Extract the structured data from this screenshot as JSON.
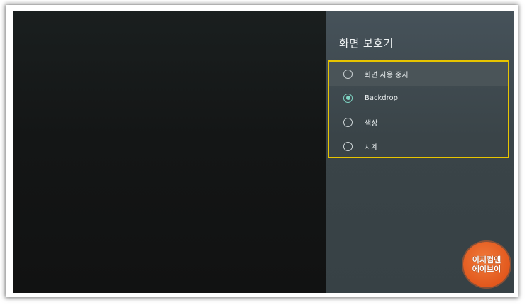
{
  "screensaver_panel": {
    "title": "화면 보호기",
    "options": [
      {
        "label": "화면 사용 중지",
        "selected": false,
        "focused": true
      },
      {
        "label": "Backdrop",
        "selected": true,
        "focused": false
      },
      {
        "label": "색상",
        "selected": false,
        "focused": false
      },
      {
        "label": "시계",
        "selected": false,
        "focused": false
      }
    ]
  },
  "watermark": {
    "line1": "이지컴앤",
    "line2": "에이브이"
  },
  "colors": {
    "accent_radio": "#7fd6c4",
    "highlight_border": "#e7c400",
    "watermark_bg": "#e2581d"
  }
}
